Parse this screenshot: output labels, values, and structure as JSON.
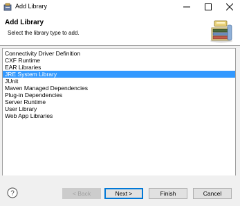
{
  "window": {
    "title": "Add Library",
    "app_icon": "eclipse-library-icon",
    "controls": [
      "minimize-icon",
      "maximize-icon",
      "close-icon"
    ]
  },
  "banner": {
    "title": "Add Library",
    "description": "Select the library type to add.",
    "icon": "library-books-icon"
  },
  "library_types": [
    "Connectivity Driver Definition",
    "CXF Runtime",
    "EAR Libraries",
    "JRE System Library",
    "JUnit",
    "Maven Managed Dependencies",
    "Plug-in Dependencies",
    "Server Runtime",
    "User Library",
    "Web App Libraries"
  ],
  "selected_library": "JRE System Library",
  "buttons": {
    "back": "< Back",
    "next": "Next >",
    "finish": "Finish",
    "cancel": "Cancel"
  },
  "colors": {
    "selection": "#3399ff",
    "default_button_border": "#0078d7"
  }
}
